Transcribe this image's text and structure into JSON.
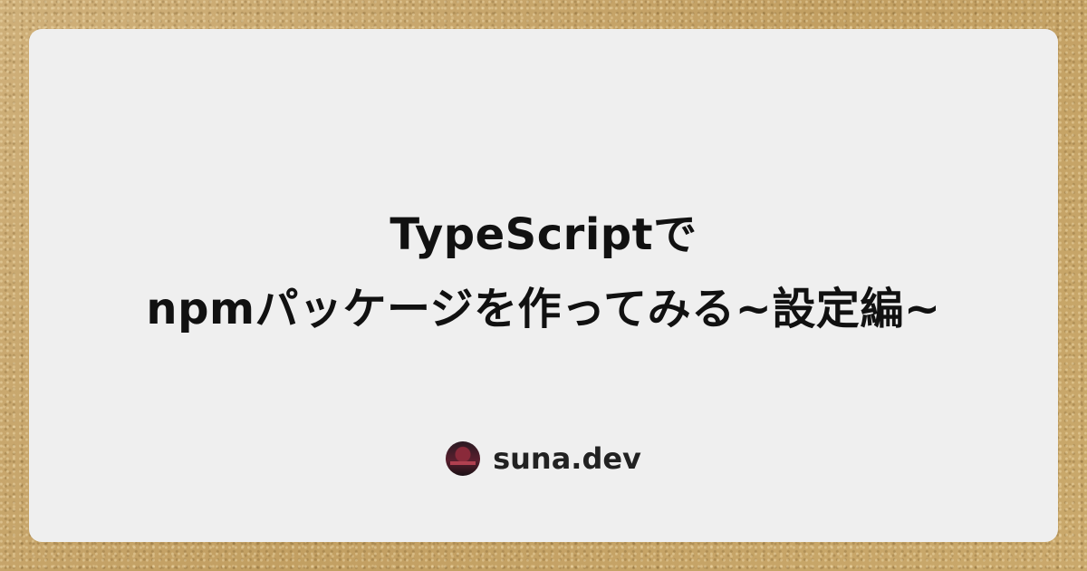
{
  "card": {
    "title_lines": [
      "TypeScriptで",
      "npmパッケージを作ってみる~設定編~"
    ],
    "author": {
      "avatar_icon": "profile-avatar",
      "name": "suna.dev"
    }
  },
  "colors": {
    "background": "#c9aa6e",
    "card": "#efefef",
    "text": "#111111"
  }
}
